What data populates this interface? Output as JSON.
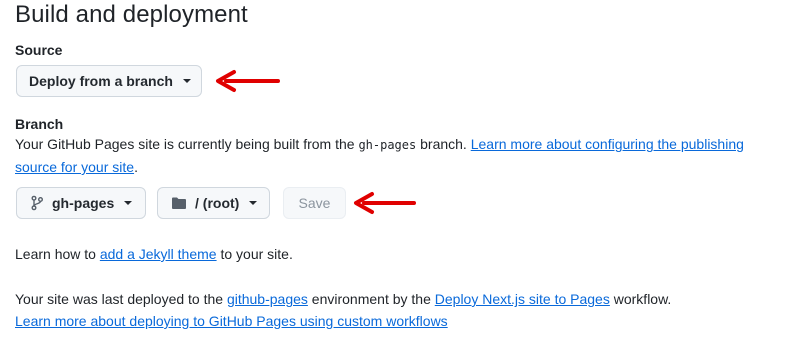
{
  "section": {
    "title": "Build and deployment"
  },
  "source": {
    "label": "Source",
    "dropdown_value": "Deploy from a branch"
  },
  "branch": {
    "label": "Branch",
    "desc_prefix": "Your GitHub Pages site is currently being built from the ",
    "branch_code": "gh-pages",
    "desc_suffix": " branch. ",
    "learn_more_link": "Learn more about configuring the publishing source for your site",
    "period": ".",
    "branch_select": "gh-pages",
    "folder_select": "/ (root)",
    "save_label": "Save"
  },
  "jekyll": {
    "prefix": "Learn how to ",
    "link": "add a Jekyll theme",
    "suffix": " to your site."
  },
  "deploy_info": {
    "prefix": "Your site was last deployed to the ",
    "env_link": "github-pages",
    "middle": " environment by the ",
    "workflow_link": "Deploy Next.js site to Pages",
    "suffix": " workflow.",
    "custom_workflows_link": "Learn more about deploying to GitHub Pages using custom workflows"
  },
  "annotations": {
    "arrow_color": "#e00000"
  }
}
